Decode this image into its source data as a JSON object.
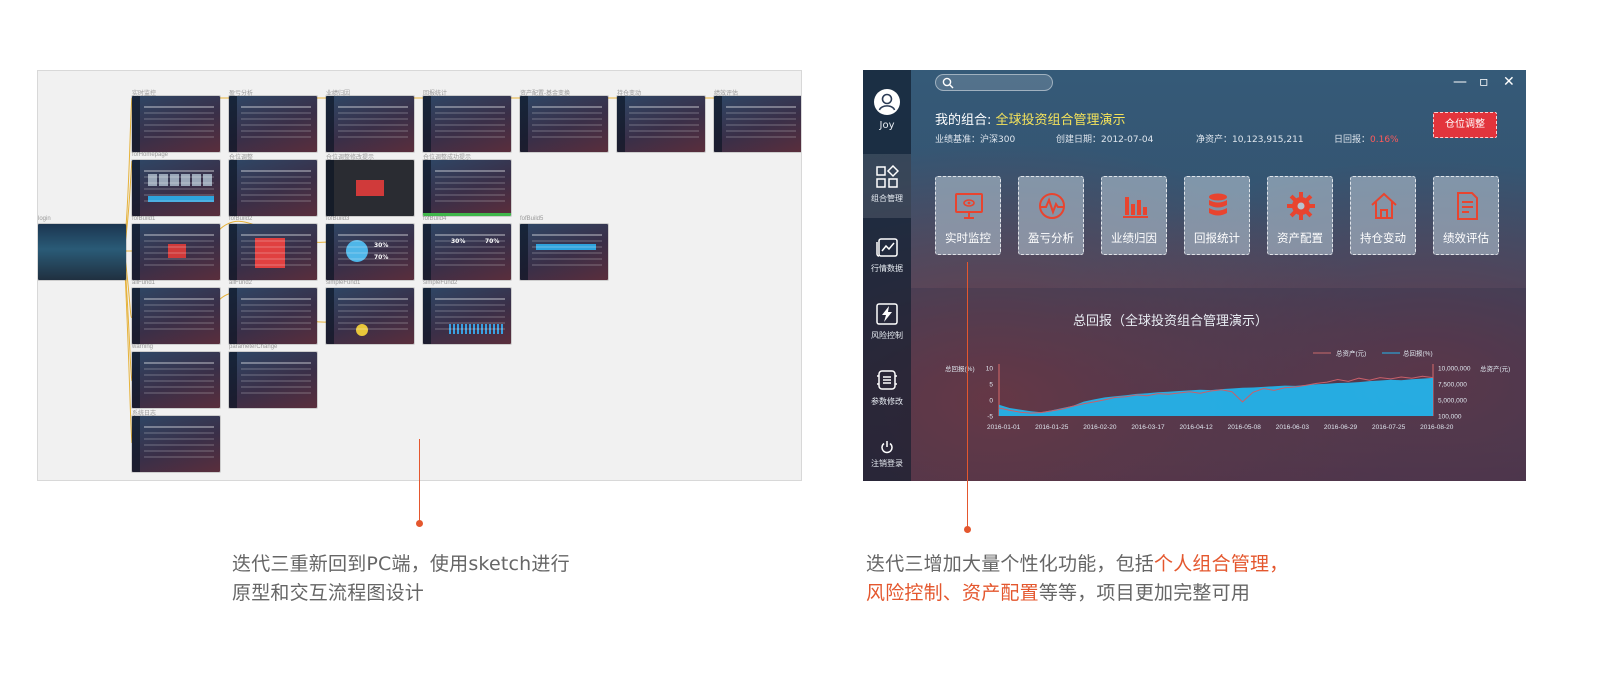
{
  "left": {
    "board": {
      "labels": {
        "login": "login",
        "row1": [
          "实时监控",
          "盈亏分析",
          "业绩归因",
          "回报统计",
          "资产配置-基金变换",
          "持仓变动",
          "绩效评估"
        ],
        "row2": [
          "fofHomepage",
          "仓位调整",
          "仓位调整修改提示",
          "仓位调整成功提示"
        ],
        "row3": [
          "fofBuild1",
          "fofBuild2",
          "fofBuild3",
          "fofBuild4",
          "fofBuild5"
        ],
        "row4": [
          "allFund1",
          "allFund2",
          "simpleFund1",
          "simpleFund2"
        ],
        "row5": [
          "warning",
          "parameterChange"
        ],
        "row6": [
          "系统日志"
        ]
      },
      "thumb_texts": {
        "pie_a": "30%",
        "pie_b": "70%"
      }
    },
    "caption": {
      "line1": "迭代三重新回到PC端，使用sketch进行",
      "line2": "原型和交互流程图设计"
    }
  },
  "app": {
    "user": {
      "name": "Joy"
    },
    "sidebar": {
      "items": [
        {
          "label": "组合管理",
          "icon": "grid-icon"
        },
        {
          "label": "行情数据",
          "icon": "chart-window-icon"
        },
        {
          "label": "风险控制",
          "icon": "lightning-icon"
        },
        {
          "label": "参数修改",
          "icon": "list-icon"
        },
        {
          "label": "注销登录",
          "icon": "power-icon"
        }
      ]
    },
    "window_controls": {
      "minimize": "—",
      "maximize": "▫",
      "close": "✕"
    },
    "portfolio": {
      "title_prefix": "我的组合:",
      "title_name": "全球投资组合管理演示",
      "benchmark": "业绩基准：沪深300",
      "created": "创建日期：2012-07-04",
      "net_assets": "净资产：10,123,915,211",
      "daily_return_label": "日回报：",
      "daily_return_value": "0.16%"
    },
    "rebalance_button": "仓位调整",
    "tiles": [
      "实时监控",
      "盈亏分析",
      "业绩归因",
      "回报统计",
      "资产配置",
      "持仓变动",
      "绩效评估"
    ],
    "accent_colors": {
      "tile_icon": "#e8442f",
      "highlight": "#f5e35b",
      "danger": "#e3343c",
      "area": "#23b6ee"
    }
  },
  "chart_data": {
    "type": "area",
    "title": "总回报（全球投资组合管理演示）",
    "ylabel_left": "总回报(%)",
    "ylabel_right": "总资产(元)",
    "legend": [
      "总资产(元)",
      "总回报(%)"
    ],
    "legend_placement": "top-right",
    "y_ticks_left": [
      "10",
      "5",
      "0",
      "-5"
    ],
    "y_ticks_right": [
      "10,000,000",
      "7,500,000",
      "5,000,000",
      "100,000"
    ],
    "x_ticks": [
      "2016-01-01",
      "2016-01-25",
      "2016-02-20",
      "2016-03-17",
      "2016-04-12",
      "2016-05-08",
      "2016-06-03",
      "2016-06-29",
      "2016-07-25",
      "2016-08-20"
    ],
    "ylim_left": [
      -5,
      10
    ],
    "series": [
      {
        "name": "总回报(%)",
        "values": [
          -1.5,
          -2.5,
          -3,
          -3.5,
          -3.8,
          -3.2,
          -2.5,
          -1.8,
          -0.5,
          0.2,
          0.8,
          1.2,
          1.5,
          1.9,
          2.1,
          2.4,
          2.6,
          2.8,
          3.0,
          3.2,
          3.1,
          3.4,
          3.6,
          3.8,
          3.9,
          4.1,
          4.3,
          4.5,
          4.4,
          4.7,
          4.9,
          5.1,
          5.3,
          5.4,
          5.6,
          5.9,
          6.1,
          6.3,
          6.2,
          6.5,
          6.7,
          6.9
        ]
      },
      {
        "name": "总资产(元)",
        "values": [
          -2.5,
          -3.2,
          -3.8,
          -4.1,
          -3.9,
          -3.4,
          -2.8,
          -1.9,
          -1.2,
          -0.6,
          0.1,
          0.8,
          1.0,
          1.6,
          1.3,
          2.0,
          1.8,
          2.2,
          2.6,
          2.1,
          2.8,
          3.2,
          2.6,
          -0.6,
          2.4,
          3.6,
          3.0,
          3.8,
          4.1,
          4.6,
          5.2,
          5.6,
          6.4,
          5.8,
          6.8,
          6.2,
          7.0,
          6.6,
          7.2,
          6.8,
          7.4,
          7.0
        ]
      }
    ]
  },
  "caption_right": {
    "line1_plain": "迭代三增加大量个性化功能，包括",
    "line1_hl": "个人组合管理，",
    "line2_hl": "风险控制、资产配置",
    "line2_plain": "等等，项目更加完整可用"
  }
}
